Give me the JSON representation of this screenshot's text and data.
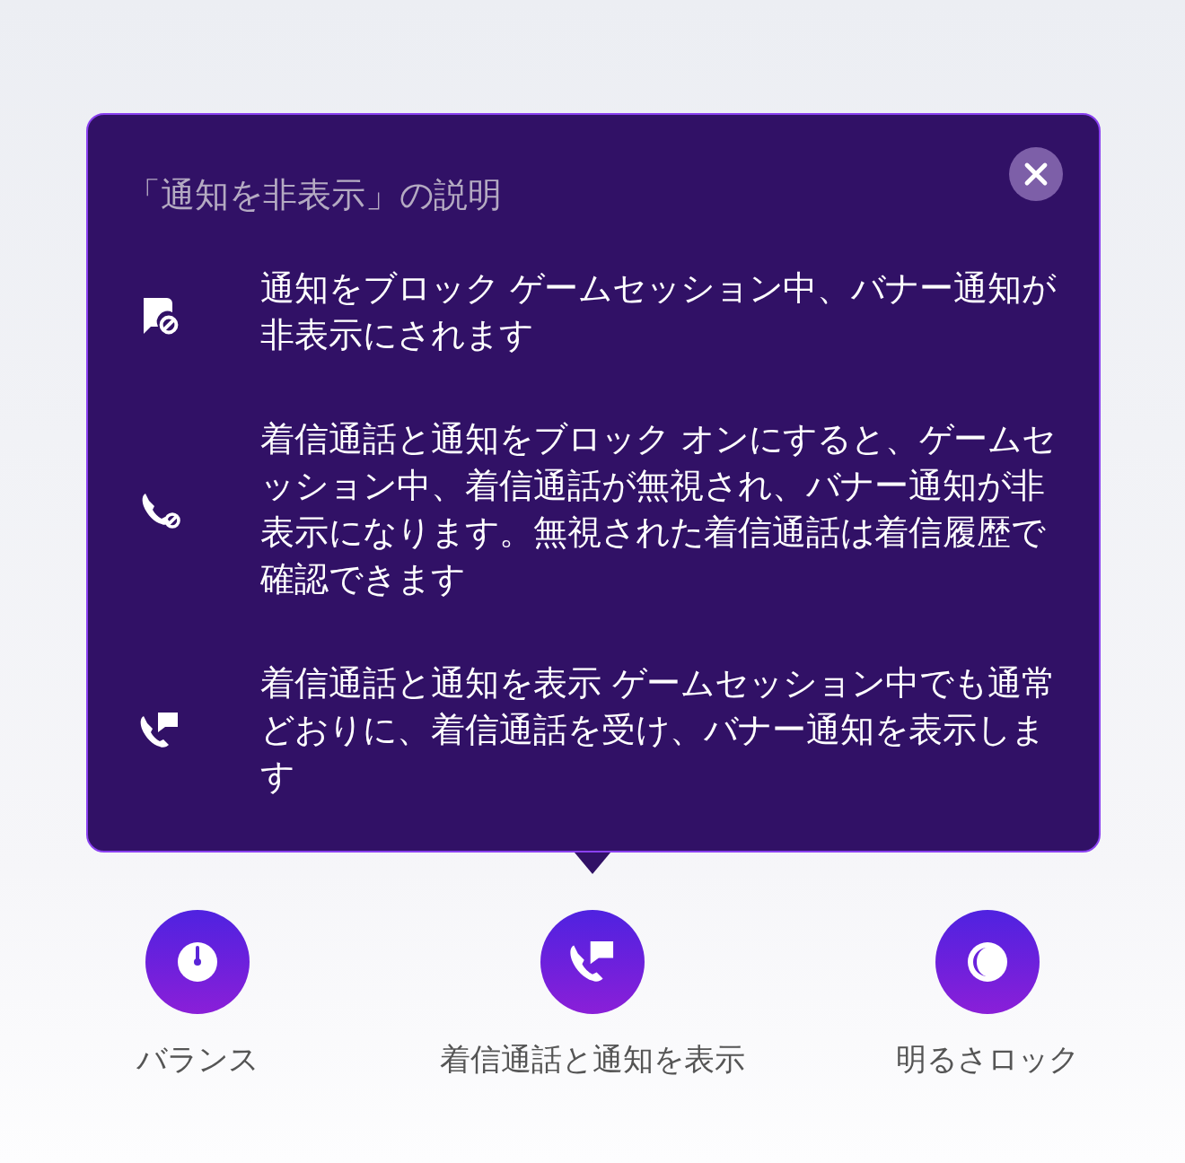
{
  "popup": {
    "title": "「通知を非表示」の説明",
    "items": [
      {
        "kind": "block-notification",
        "text": "通知をブロック ゲームセッション中、バナー通知が非表示にされます"
      },
      {
        "kind": "block-call",
        "text": "着信通話と通知をブロック オンにすると、ゲームセッション中、着信通話が無視され、バナー通知が非表示になります。無視された着信通話は着信履歴で確認できます"
      },
      {
        "kind": "show-call",
        "text": "着信通話と通知を表示 ゲームセッション中でも通常どおりに、着信通話を受け、バナー通知を表示します"
      }
    ]
  },
  "modes": [
    {
      "kind": "balance",
      "label": "バランス"
    },
    {
      "kind": "show-call",
      "label": "着信通話と通知を表示"
    },
    {
      "kind": "brightness-lock",
      "label": "明るさロック"
    }
  ]
}
